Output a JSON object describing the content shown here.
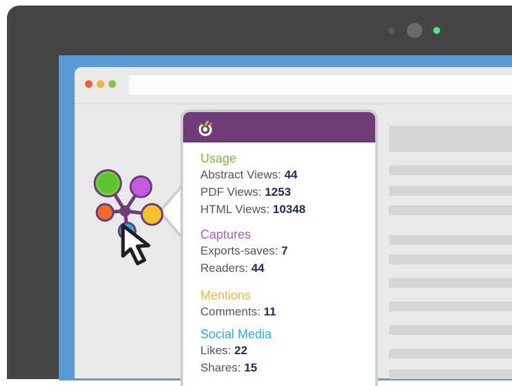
{
  "colors": {
    "usage": "#7cbb45",
    "captures": "#b358d6",
    "mentions": "#f0b93b",
    "social_media": "#2fa9d7",
    "header": "#6f3b78",
    "value": "#1f2d5c"
  },
  "icons": {
    "logo": "plumx-logo-icon",
    "badge": "plumx-flower-badge-icon",
    "cursor": "cursor-arrow-icon"
  },
  "popup": {
    "sections": [
      {
        "title": "Usage",
        "rows": [
          {
            "label": "Abstract Views:",
            "value": "44"
          },
          {
            "label": "PDF Views:",
            "value": "1253"
          },
          {
            "label": "HTML Views:",
            "value": "10348"
          }
        ]
      },
      {
        "title": "Captures",
        "rows": [
          {
            "label": "Exports-saves:",
            "value": "7"
          },
          {
            "label": "Readers:",
            "value": "44"
          }
        ]
      },
      {
        "title": "Mentions",
        "rows": [
          {
            "label": "Comments:",
            "value": "11"
          }
        ]
      },
      {
        "title": "Social Media",
        "rows": [
          {
            "label": "Likes:",
            "value": "22"
          },
          {
            "label": "Shares:",
            "value": "15"
          }
        ]
      }
    ]
  }
}
